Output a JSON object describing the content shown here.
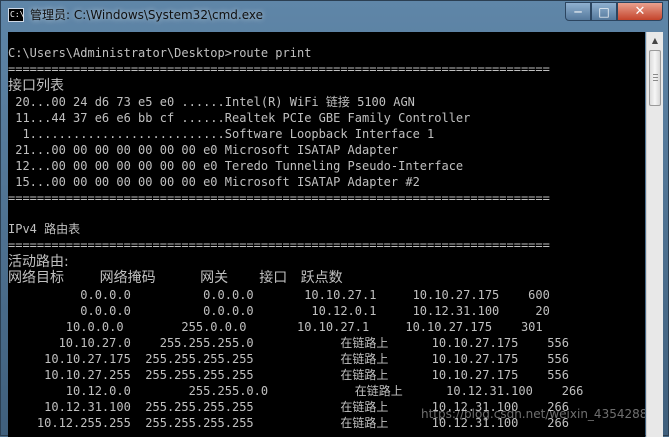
{
  "window": {
    "title": "管理员: C:\\Windows\\System32\\cmd.exe",
    "app_icon_text": "C:\\",
    "controls": {
      "minimize": "─",
      "maximize": "□",
      "close": "✕"
    }
  },
  "console": {
    "lines": [
      "C:\\Users\\Administrator\\Desktop>route print",
      "===========================================================================",
      "接口列表",
      " 20...00 24 d6 73 e5 e0 ......Intel(R) WiFi 链接 5100 AGN",
      " 11...44 37 e6 e6 bb cf ......Realtek PCIe GBE Family Controller",
      "  1...........................Software Loopback Interface 1",
      " 21...00 00 00 00 00 00 00 e0 Microsoft ISATAP Adapter",
      " 12...00 00 00 00 00 00 00 e0 Teredo Tunneling Pseudo-Interface",
      " 15...00 00 00 00 00 00 00 e0 Microsoft ISATAP Adapter #2",
      "===========================================================================",
      "IPv4 路由表",
      "===========================================================================",
      "活动路由:",
      "网络目标        网络掩码          网关       接口   跃点数",
      "          0.0.0.0          0.0.0.0       10.10.27.1     10.10.27.175    600",
      "          0.0.0.0          0.0.0.0        10.12.0.1     10.12.31.100     20",
      "        10.0.0.0        255.0.0.0       10.10.27.1     10.10.27.175    301",
      "       10.10.27.0    255.255.255.0            在链路上      10.10.27.175    556",
      "     10.10.27.175  255.255.255.255            在链路上      10.10.27.175    556",
      "     10.10.27.255  255.255.255.255            在链路上      10.10.27.175    556",
      "        10.12.0.0        255.255.0.0            在链路上      10.12.31.100    266",
      "     10.12.31.100  255.255.255.255            在链路上      10.12.31.100    266",
      "    10.12.255.255  255.255.255.255            在链路上      10.12.31.100    266"
    ]
  },
  "watermark": "https://blog.csdn.net/weixin_4354288..."
}
